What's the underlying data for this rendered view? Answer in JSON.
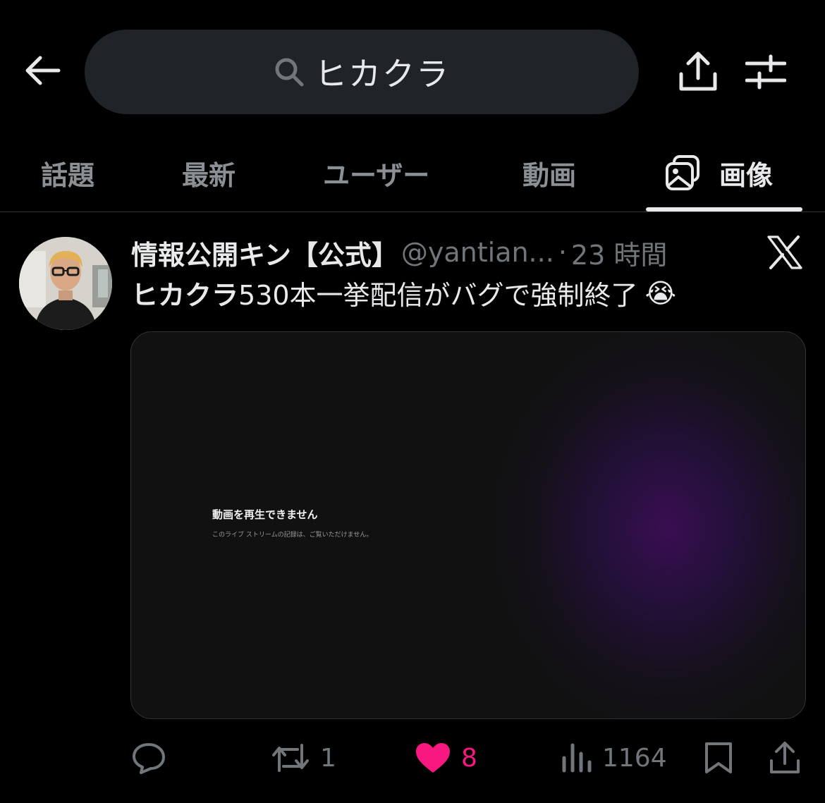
{
  "search": {
    "query": "ヒカクラ"
  },
  "icons": {
    "back": "back-arrow-icon",
    "search": "search-icon",
    "share": "share-icon",
    "filter": "filter-sliders-icon",
    "images_tab": "images-icon",
    "x_logo": "x-logo-icon",
    "reply": "reply-icon",
    "retweet": "retweet-icon",
    "like": "heart-icon",
    "views": "views-icon",
    "bookmark": "bookmark-icon"
  },
  "tabs": [
    {
      "label": "話題",
      "active": false
    },
    {
      "label": "最新",
      "active": false
    },
    {
      "label": "ユーザー",
      "active": false
    },
    {
      "label": "動画",
      "active": false
    },
    {
      "label": "画像",
      "active": true
    }
  ],
  "post": {
    "author": "情報公開キン【公式】",
    "handle": "@yantian...",
    "separator": "·",
    "time": "23 時間",
    "text_bold": "ヒカクラ",
    "text_rest": "530本一挙配信がバグで強制終了",
    "emoji": "😭",
    "media": {
      "title": "動画を再生できません",
      "subtitle": "このライブ ストリームの記録は、ご覧いただけません。"
    },
    "stats": {
      "reply": "",
      "retweets": "1",
      "likes": "8",
      "views": "1164"
    }
  },
  "colors": {
    "background": "#000000",
    "search_pill": "#202327",
    "muted": "#71767b",
    "like": "#f91880",
    "divider": "#2f3336"
  }
}
